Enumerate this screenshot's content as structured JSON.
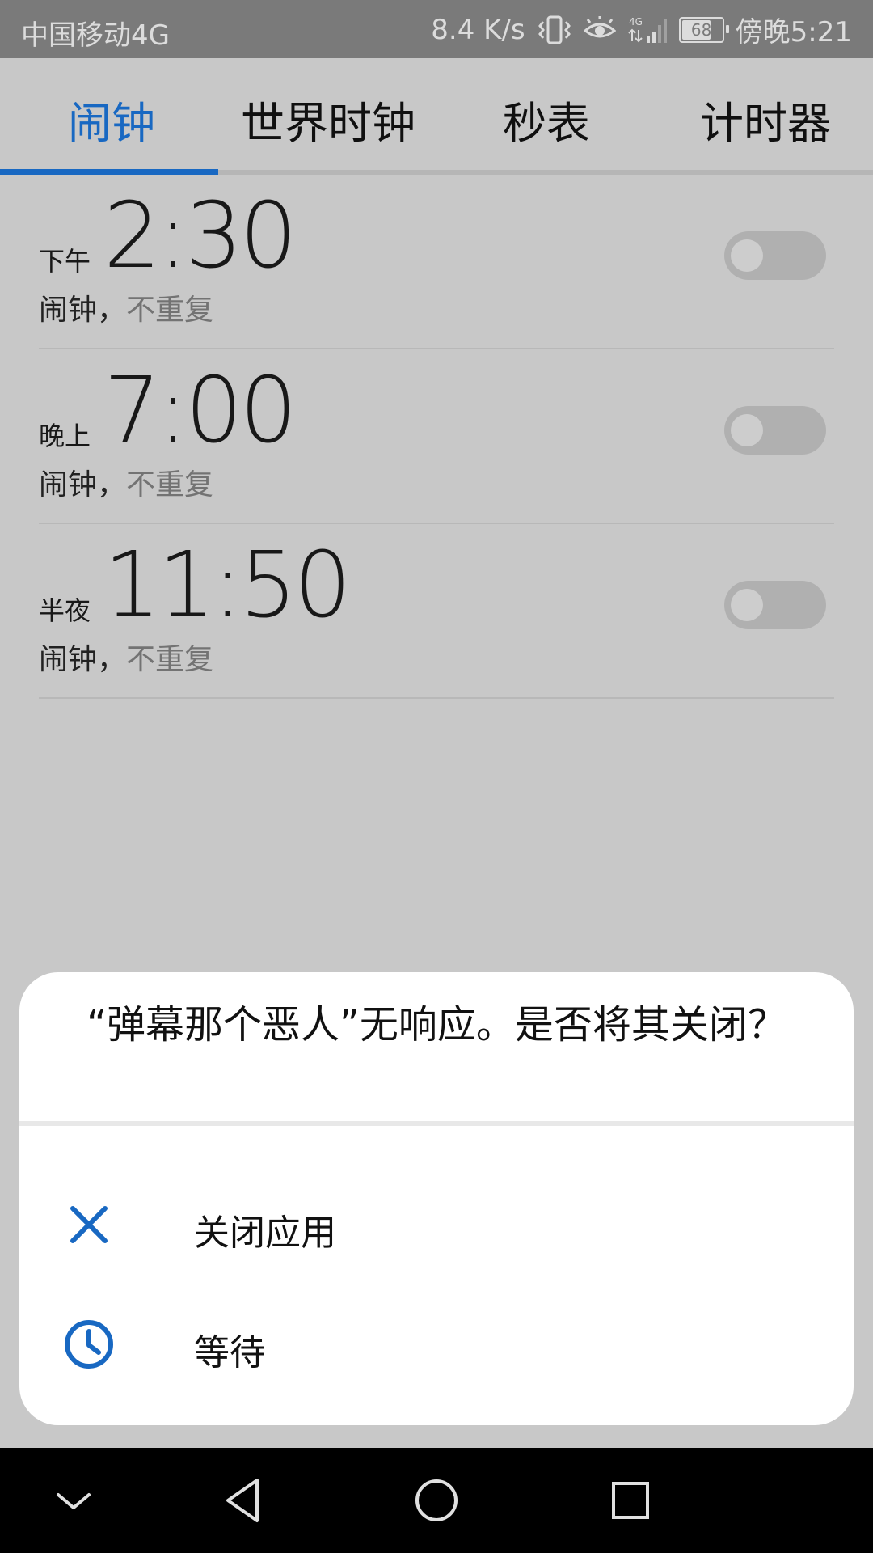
{
  "status_bar": {
    "carrier": "中国移动4G",
    "speed": "8.4 K/s",
    "network": "4G",
    "battery": "68",
    "time": "傍晚5:21"
  },
  "tabs": [
    {
      "label": "闹钟",
      "active": true
    },
    {
      "label": "世界时钟",
      "active": false
    },
    {
      "label": "秒表",
      "active": false
    },
    {
      "label": "计时器",
      "active": false
    }
  ],
  "alarms": [
    {
      "period": "下午",
      "time": "2:30",
      "name": "闹钟，",
      "repeat": "不重复",
      "enabled": false
    },
    {
      "period": "晚上",
      "time": "7:00",
      "name": "闹钟，",
      "repeat": "不重复",
      "enabled": false
    },
    {
      "period": "半夜",
      "time": "11:50",
      "name": "闹钟，",
      "repeat": "不重复",
      "enabled": false
    }
  ],
  "dialog": {
    "title": "“弹幕那个恶人”无响应。是否将其关闭？",
    "options": [
      {
        "label": "关闭应用",
        "icon": "close-icon"
      },
      {
        "label": "等待",
        "icon": "clock-icon"
      }
    ]
  },
  "colors": {
    "accent": "#1868c2",
    "scrim_bg": "#c8c8c8",
    "status_bar": "#7a7a7a"
  }
}
